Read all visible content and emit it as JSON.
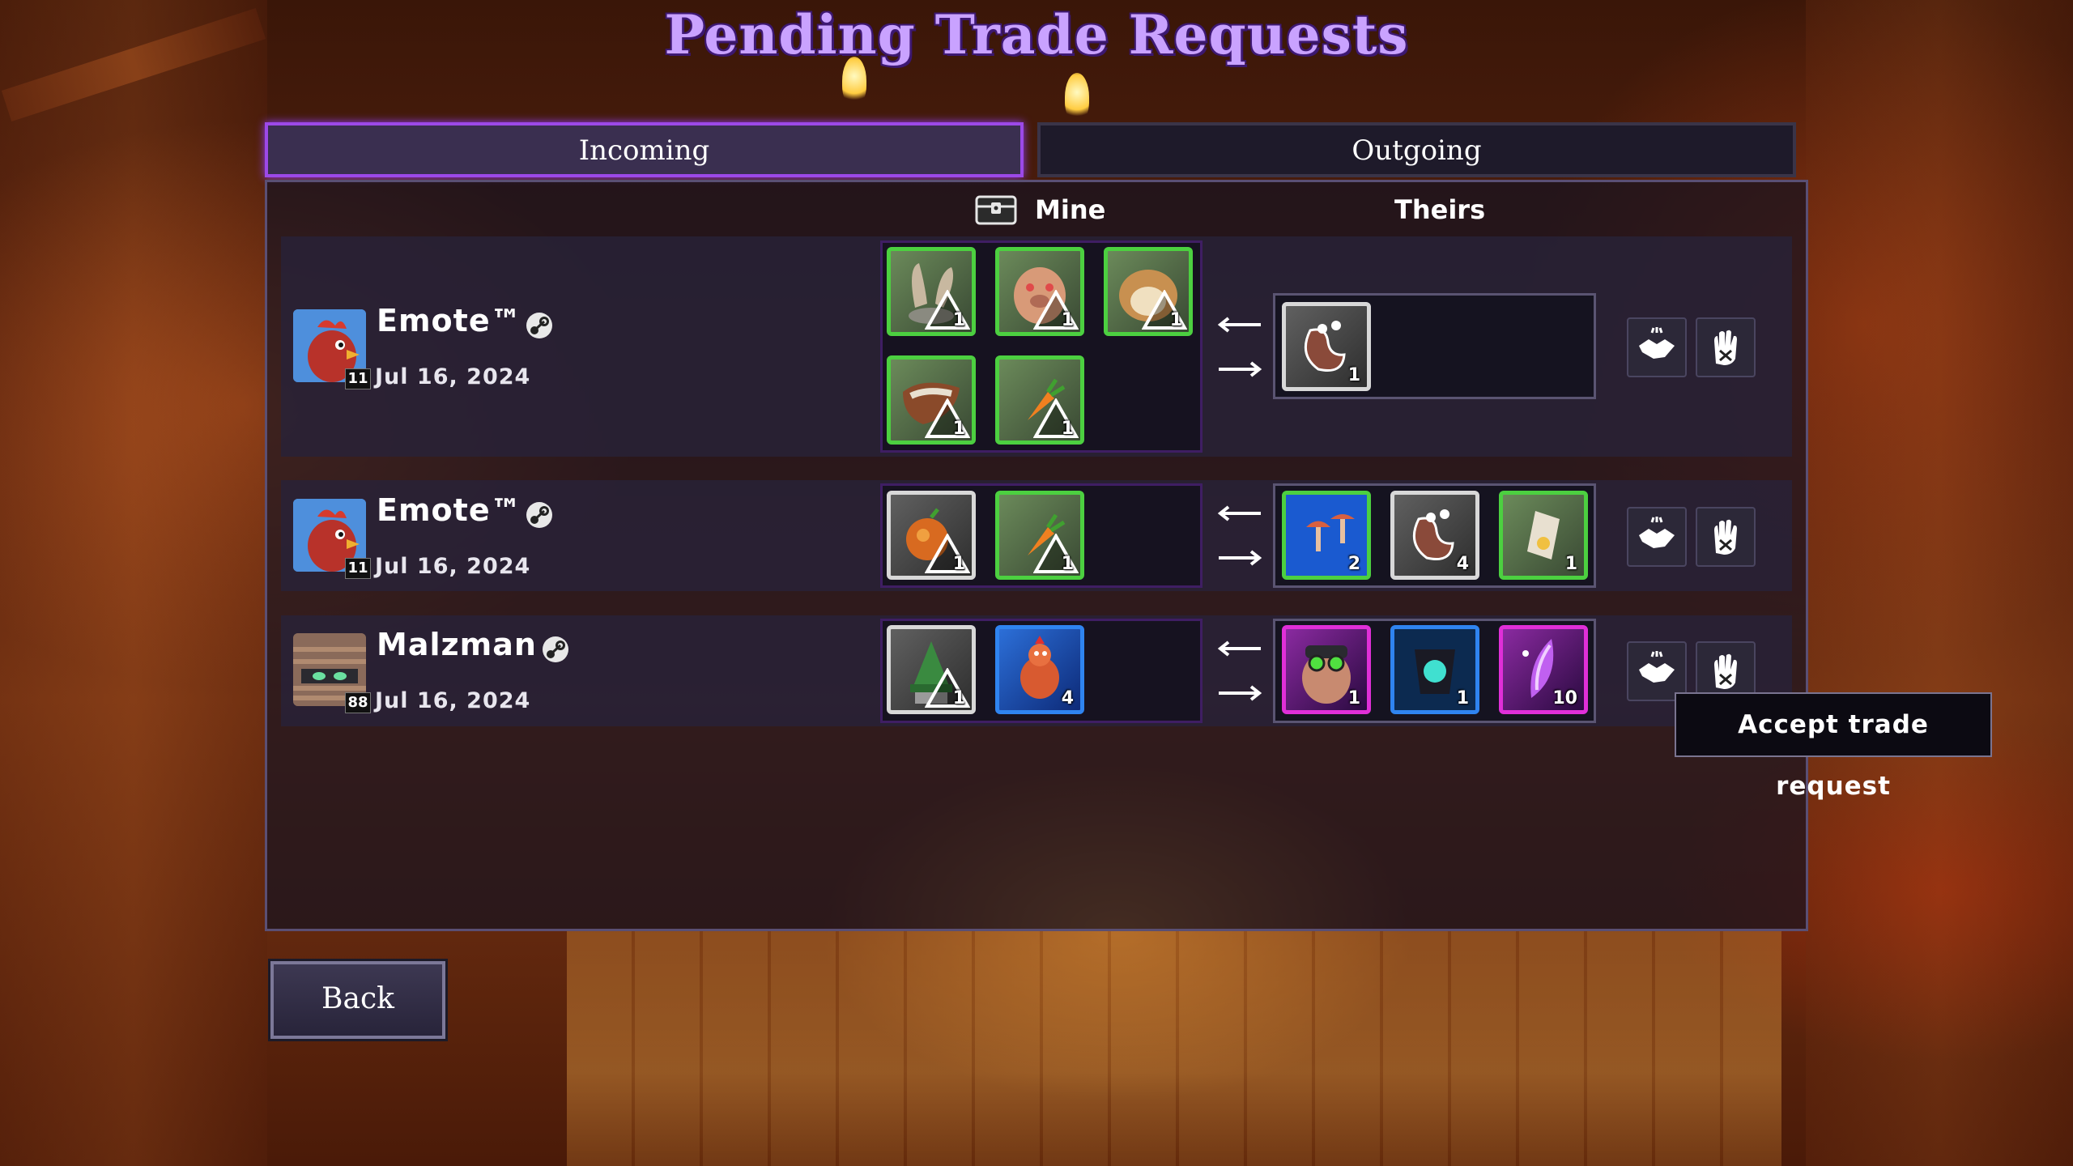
{
  "title": "Pending Trade Requests",
  "tabs": [
    {
      "label": "Incoming",
      "active": true
    },
    {
      "label": "Outgoing",
      "active": false
    }
  ],
  "columns": {
    "mine": "Mine",
    "theirs": "Theirs"
  },
  "trades": [
    {
      "player": "Emote™",
      "level": "11",
      "date": "Jul 16, 2024",
      "mine": [
        {
          "icon": "rabbit-ears-item",
          "rarity": "green",
          "qty": "1",
          "warning": true
        },
        {
          "icon": "pig-face-item",
          "rarity": "green",
          "qty": "1",
          "warning": true
        },
        {
          "icon": "fur-pelt-item",
          "rarity": "green",
          "qty": "1",
          "warning": true
        },
        {
          "icon": "meat-chunk-item",
          "rarity": "green",
          "qty": "1",
          "warning": true
        },
        {
          "icon": "carrot-item",
          "rarity": "green",
          "qty": "1",
          "warning": true
        }
      ],
      "theirs": [
        {
          "icon": "bean-item",
          "rarity": "grey",
          "qty": "1"
        }
      ]
    },
    {
      "player": "Emote™",
      "level": "11",
      "date": "Jul 16, 2024",
      "mine": [
        {
          "icon": "orange-item",
          "rarity": "grey",
          "qty": "1",
          "warning": true
        },
        {
          "icon": "carrot-item",
          "rarity": "green",
          "qty": "1",
          "warning": true
        }
      ],
      "theirs": [
        {
          "icon": "mushroom-item",
          "rarity": "green",
          "qty": "2"
        },
        {
          "icon": "bean-item",
          "rarity": "grey",
          "qty": "4"
        },
        {
          "icon": "flower-item",
          "rarity": "green",
          "qty": "1"
        }
      ]
    },
    {
      "player": "Malzman",
      "level": "88",
      "date": "Jul 16, 2024",
      "mine": [
        {
          "icon": "wizard-hat-item",
          "rarity": "grey",
          "qty": "1",
          "warning": true
        },
        {
          "icon": "chicken-creature-item",
          "rarity": "blue",
          "qty": "4",
          "warning": false
        }
      ],
      "theirs": [
        {
          "icon": "goggles-man-item",
          "rarity": "pink",
          "qty": "1"
        },
        {
          "icon": "glowing-cloak-item",
          "rarity": "blue",
          "qty": "1"
        },
        {
          "icon": "crystal-shard-item",
          "rarity": "pink",
          "qty": "10"
        }
      ]
    }
  ],
  "tooltip": "Accept trade request",
  "back_label": "Back",
  "colors": {
    "accent": "#9c49e8",
    "title": "#c9a2ff",
    "green_rarity": "#4cd040",
    "blue_rarity": "#2f84f0",
    "pink_rarity": "#e02fd8",
    "grey_rarity": "#d8d8d8"
  }
}
